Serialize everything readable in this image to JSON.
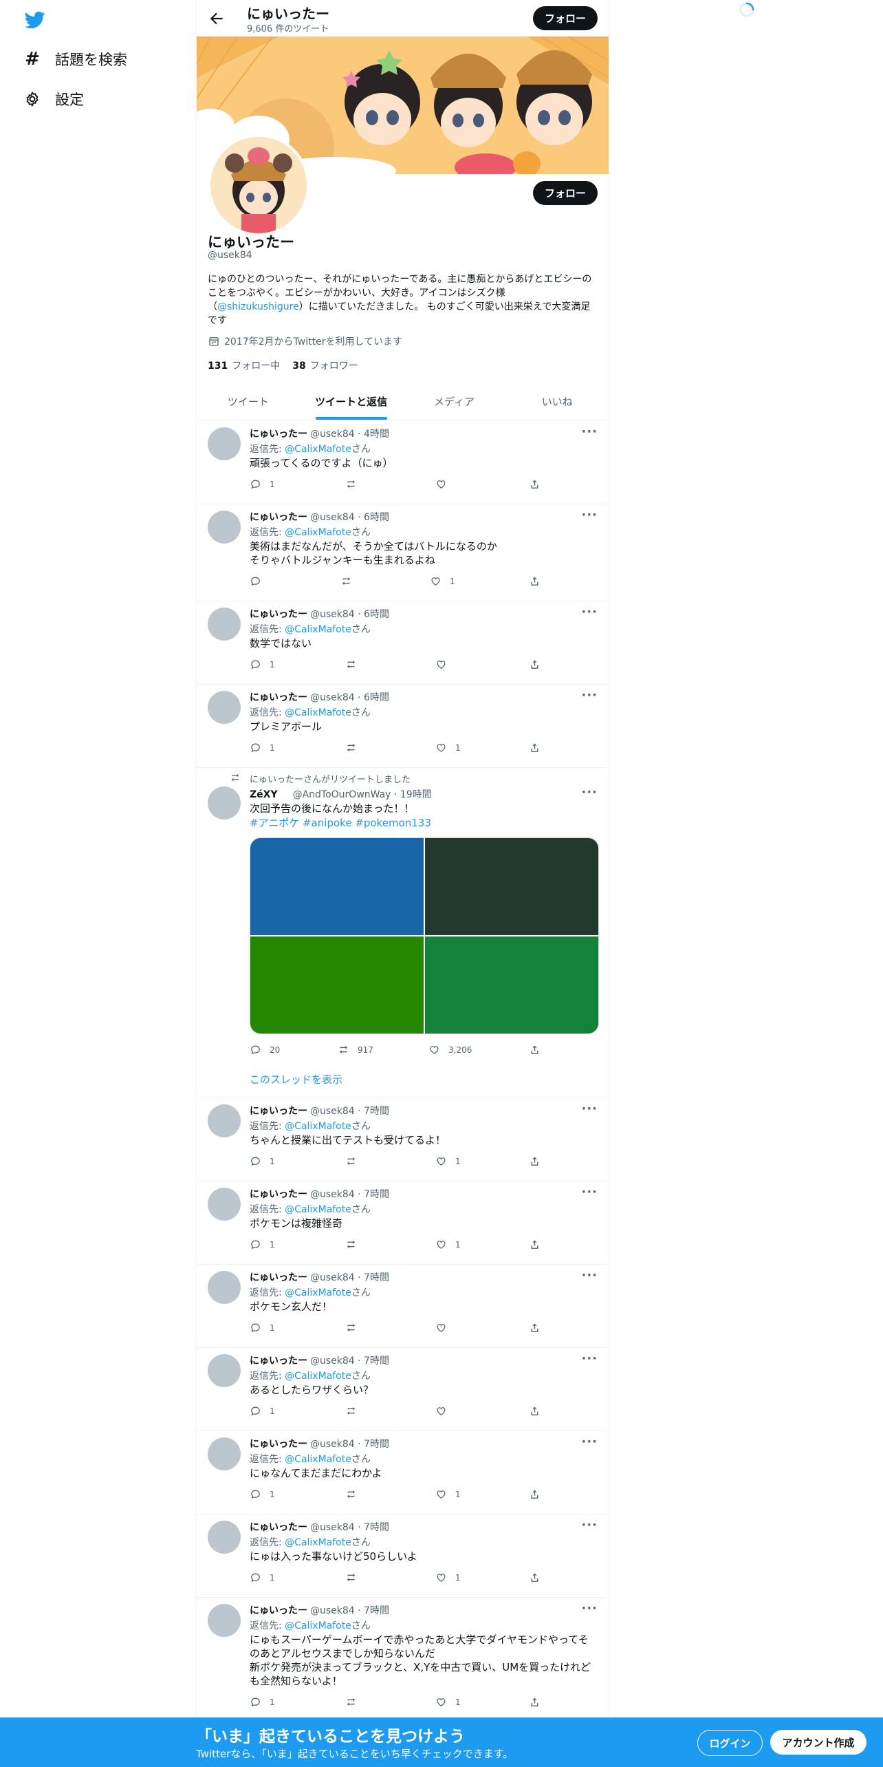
{
  "nav": {
    "explore_label": "話題を検索",
    "settings_label": "設定"
  },
  "header": {
    "name": "にゅいったー",
    "tweet_count": "9,606 件のツイート",
    "follow_label": "フォロー"
  },
  "profile": {
    "name": "にゅいったー",
    "handle": "@usek84",
    "bio_pre": "にゅのひとのついったー、それがにゅいったーである。主に愚痴とからあげとエビシーのことをつぶやく。エビシーがかわいい、大好き。アイコンはシズク様（",
    "bio_link": "@shizukushigure",
    "bio_post": "）に描いていただきました。 ものすごく可愛い出来栄えで大変満足です",
    "joined": "2017年2月からTwitterを利用しています",
    "following_count": "131",
    "following_label": "フォロー中",
    "followers_count": "38",
    "followers_label": "フォロワー",
    "follow_label": "フォロー"
  },
  "tabs": [
    "ツイート",
    "ツイートと返信",
    "メディア",
    "いいね"
  ],
  "common": {
    "reply_prefix": "返信先: ",
    "reply_suffix": "さん",
    "more": "···"
  },
  "tweets": [
    {
      "name": "にゅいったー",
      "meta": "@usek84 · 4時間",
      "reply_to": "@CalixMafote",
      "text": "頑張ってくるのですよ（にゅ）",
      "replies": "1",
      "retweets": "",
      "likes": ""
    },
    {
      "name": "にゅいったー",
      "meta": "@usek84 · 6時間",
      "reply_to": "@CalixMafote",
      "text": "美術はまだなんだが、そうか全てはバトルになるのか\nそりゃバトルジャンキーも生まれるよね",
      "replies": "",
      "retweets": "",
      "likes": "1"
    },
    {
      "name": "にゅいったー",
      "meta": "@usek84 · 6時間",
      "reply_to": "@CalixMafote",
      "text": "数学ではない",
      "replies": "1",
      "retweets": "",
      "likes": ""
    },
    {
      "name": "にゅいったー",
      "meta": "@usek84 · 6時間",
      "reply_to": "@CalixMafote",
      "text": "プレミアボール",
      "replies": "1",
      "retweets": "",
      "likes": "1"
    }
  ],
  "retweet": {
    "label": "にゅいったーさんがリツイートしました",
    "name": "ZéXY",
    "meta": "@AndToOurOwnWay · 19時間",
    "text": "次回予告の後になんか始まった！！",
    "hashtags": "#アニポケ #anipoke #pokemon133",
    "media_colors": [
      "#1a65a8",
      "#23392e",
      "#238700",
      "#13833a"
    ],
    "replies": "20",
    "retweets": "917",
    "likes": "3,206",
    "show_thread": "このスレッドを表示"
  },
  "tweets2": [
    {
      "name": "にゅいったー",
      "meta": "@usek84 · 7時間",
      "reply_to": "@CalixMafote",
      "text": "ちゃんと授業に出てテストも受けてるよ！",
      "replies": "1",
      "retweets": "",
      "likes": "1"
    },
    {
      "name": "にゅいったー",
      "meta": "@usek84 · 7時間",
      "reply_to": "@CalixMafote",
      "text": "ポケモンは複雑怪奇",
      "replies": "1",
      "retweets": "",
      "likes": "1"
    },
    {
      "name": "にゅいったー",
      "meta": "@usek84 · 7時間",
      "reply_to": "@CalixMafote",
      "text": "ポケモン玄人だ！",
      "replies": "1",
      "retweets": "",
      "likes": ""
    },
    {
      "name": "にゅいったー",
      "meta": "@usek84 · 7時間",
      "reply_to": "@CalixMafote",
      "text": "あるとしたらワザくらい？",
      "replies": "1",
      "retweets": "",
      "likes": ""
    },
    {
      "name": "にゅいったー",
      "meta": "@usek84 · 7時間",
      "reply_to": "@CalixMafote",
      "text": "にゅなんてまだまだにわかよ",
      "replies": "1",
      "retweets": "",
      "likes": "1"
    },
    {
      "name": "にゅいったー",
      "meta": "@usek84 · 7時間",
      "reply_to": "@CalixMafote",
      "text": "にゅは入った事ないけど50らしいよ",
      "replies": "1",
      "retweets": "",
      "likes": "1"
    },
    {
      "name": "にゅいったー",
      "meta": "@usek84 · 7時間",
      "reply_to": "@CalixMafote",
      "text": "にゅもスーパーゲームボーイで赤やったあと大学でダイヤモンドやってそのあとアルセウスまでしか知らないんだ\n新ポケ発売が決まってブラックと、X,Yを中古で買い、UMを買ったけれども全然知らないよ！",
      "replies": "1",
      "retweets": "",
      "likes": "1"
    }
  ],
  "bottom": {
    "title": "「いま」起きていることを見つけよう",
    "subtitle": "Twitterなら、「いま」起きていることをいち早くチェックできます。",
    "login": "ログイン",
    "signup": "アカウント作成"
  },
  "colors": {
    "accent": "#1d9bf0",
    "dark": "#0f1419",
    "muted": "#536471"
  }
}
